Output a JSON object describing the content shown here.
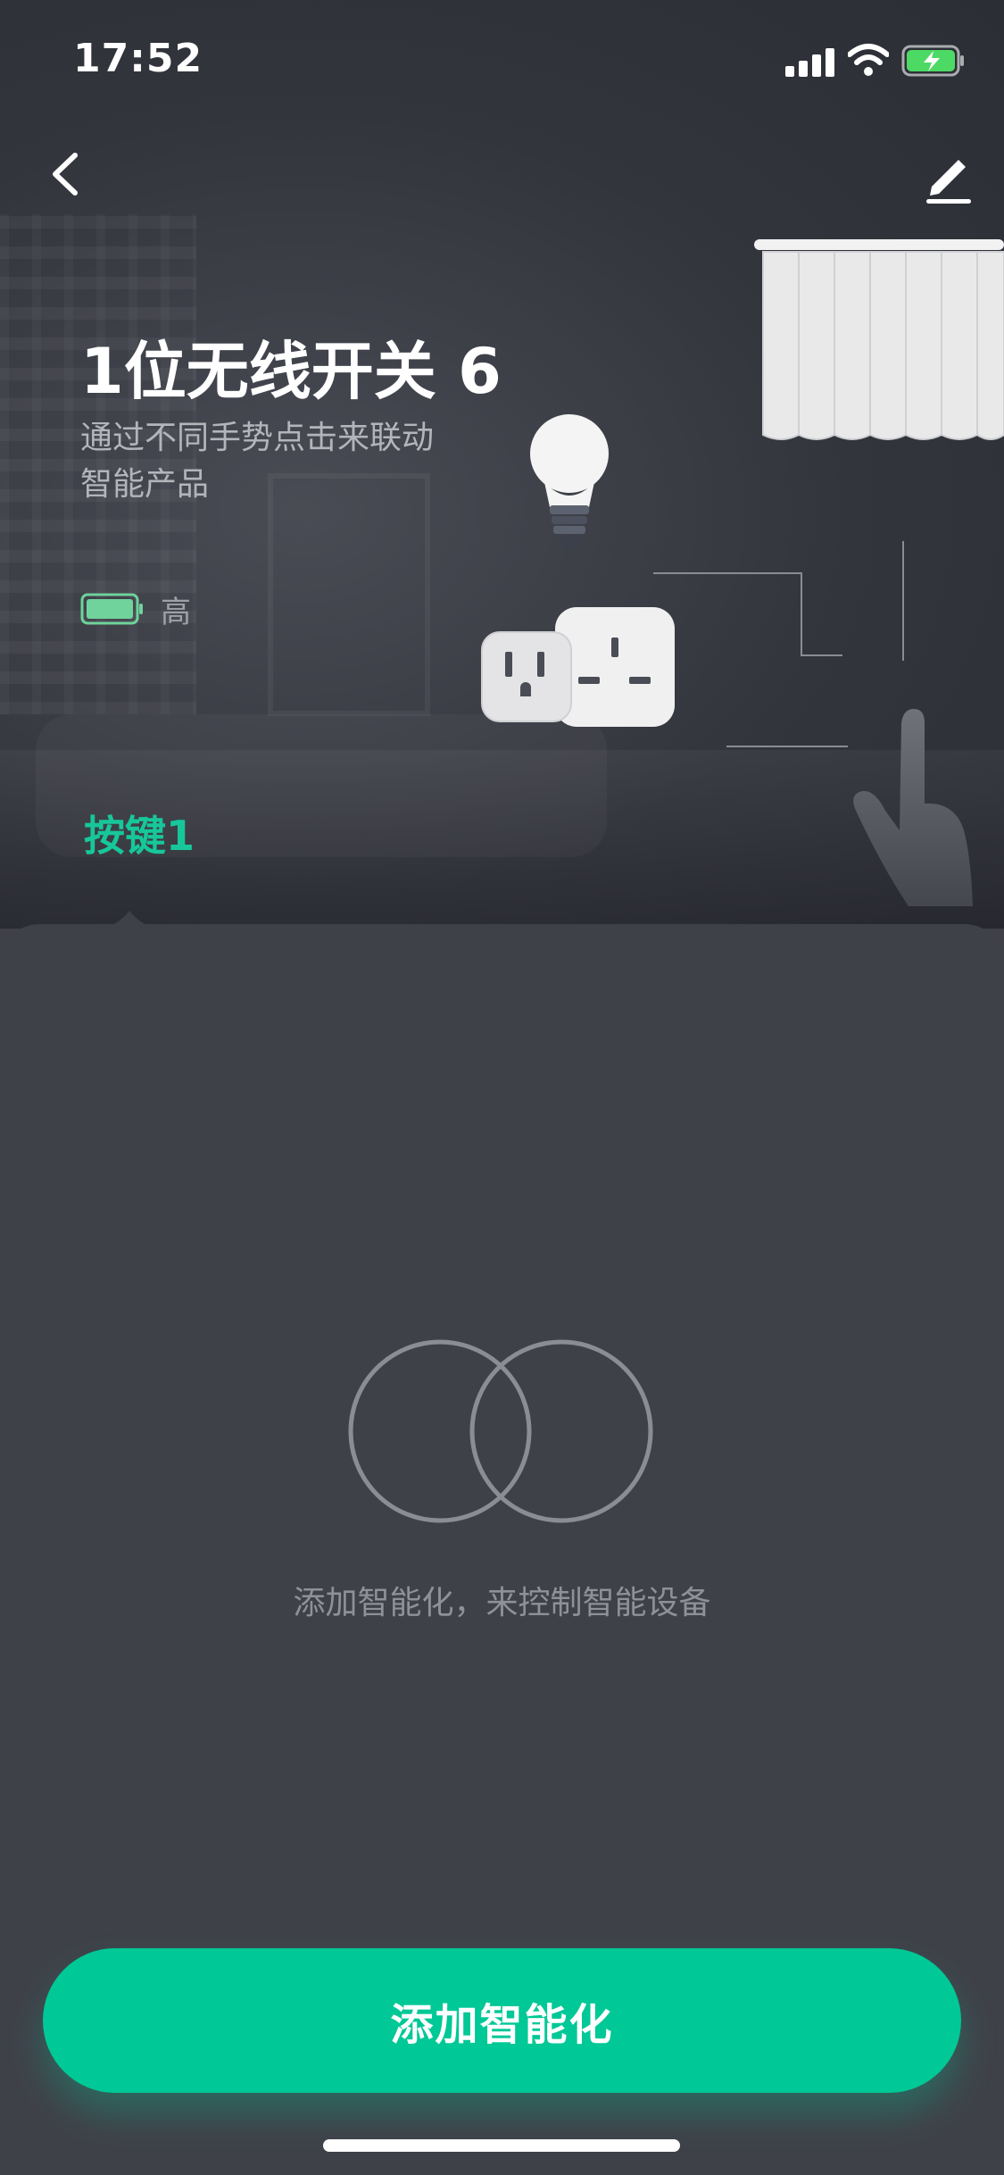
{
  "status_bar": {
    "time": "17:52"
  },
  "header": {
    "back_icon": "chevron-left-icon",
    "edit_icon": "pencil-icon"
  },
  "device": {
    "name": "1位无线开关 6",
    "description": "通过不同手势点击来联动智能产品",
    "battery_level_label": "高",
    "battery_color": "#6fd39b"
  },
  "key": {
    "label": "按键1"
  },
  "empty_state": {
    "icon": "two-circles-icon",
    "message": "添加智能化，来控制智能设备"
  },
  "cta": {
    "label": "添加智能化"
  },
  "colors": {
    "accent": "#00c896",
    "background": "#3f4149"
  }
}
